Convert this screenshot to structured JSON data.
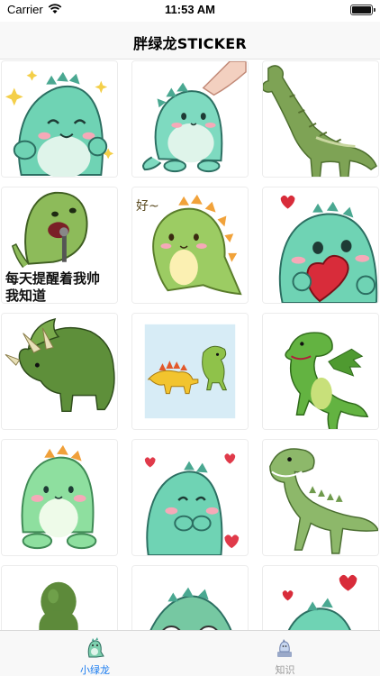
{
  "status_bar": {
    "carrier": "Carrier",
    "time": "11:53 AM"
  },
  "nav": {
    "title": "胖绿龙STICKER"
  },
  "stickers": [
    {
      "id": "sticker-1",
      "caption": ""
    },
    {
      "id": "sticker-2",
      "caption": ""
    },
    {
      "id": "sticker-3",
      "caption": ""
    },
    {
      "id": "sticker-4",
      "caption_line1": "每天提醒着我帅",
      "caption_line2": "我知道"
    },
    {
      "id": "sticker-5",
      "caption": "好~"
    },
    {
      "id": "sticker-6",
      "caption": ""
    }
  ],
  "tabs": [
    {
      "label": "小绿龙",
      "icon": "dino-icon",
      "active": true
    },
    {
      "label": "知识",
      "icon": "knowledge-icon",
      "active": false
    }
  ],
  "colors": {
    "accent": "#1a7cf0",
    "mint": "#6fd3b4",
    "green": "#7cae4a",
    "inactive": "#9a9a9a"
  }
}
